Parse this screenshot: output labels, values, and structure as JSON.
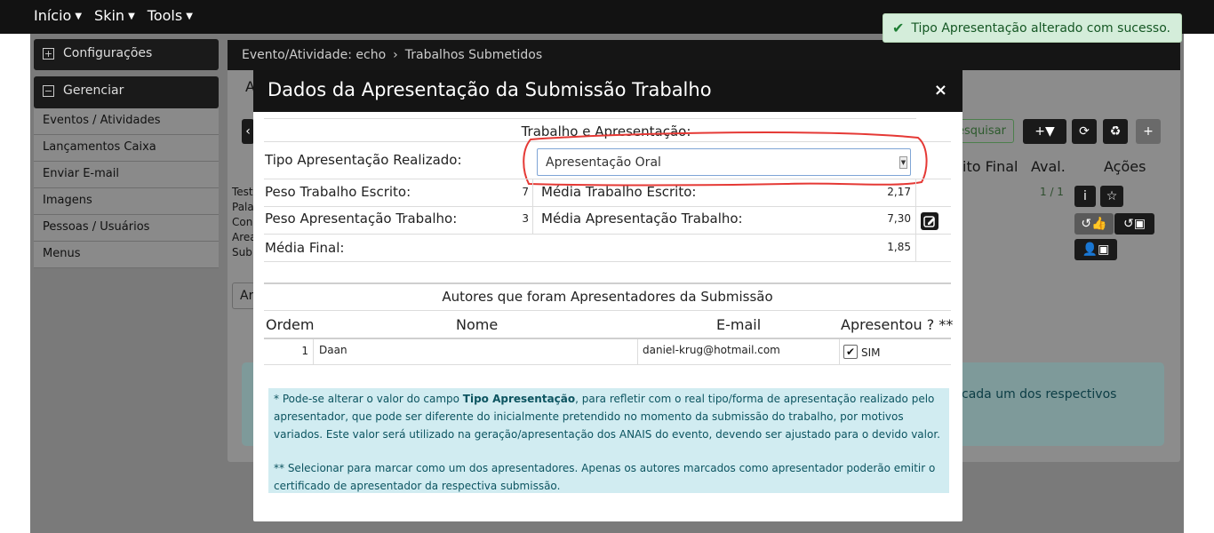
{
  "topnav": {
    "items": [
      "Início",
      "Skin",
      "Tools"
    ]
  },
  "sidebar": {
    "config_label": "Configurações",
    "manage_label": "Gerenciar",
    "items": [
      "Eventos / Atividades",
      "Lançamentos Caixa",
      "Enviar E-mail",
      "Imagens",
      "Pessoas / Usuários",
      "Menus"
    ]
  },
  "main": {
    "breadcrumb_event": "Evento/Atividade: echo",
    "breadcrumb_page": "Trabalhos Submetidos",
    "search_label": "esquisar",
    "col_final": "ito Final",
    "col_aval": "Aval.",
    "col_acoes": "Ações",
    "aval_value": "1 / 1",
    "info_fragment": "cada um dos respectivos",
    "left_fragments": [
      "Test",
      "Pala",
      "Con",
      "Area",
      "Sub"
    ],
    "tab_fragment": "Ar",
    "a_fragment": "A"
  },
  "toast": {
    "message": "Tipo Apresentação alterado com sucesso."
  },
  "modal": {
    "title": "Dados da Apresentação da Submissão Trabalho",
    "close": "×",
    "section1_title": "Trabalho e Apresentação:",
    "tipo_label": "Tipo Apresentação Realizado:",
    "tipo_value": "Apresentação Oral",
    "peso_escrito_label": "Peso Trabalho Escrito:",
    "peso_escrito_value": "7",
    "media_escrito_label": "Média Trabalho Escrito:",
    "media_escrito_value": "2,17",
    "peso_apres_label": "Peso Apresentação Trabalho:",
    "peso_apres_value": "3",
    "media_apres_label": "Média Apresentação Trabalho:",
    "media_apres_value": "7,30",
    "media_final_label": "Média Final:",
    "media_final_value": "1,85",
    "section2_title": "Autores que foram Apresentadores da Submissão",
    "table_headers": {
      "ordem": "Ordem",
      "nome": "Nome",
      "email": "E-mail",
      "apresentou": "Apresentou ? **"
    },
    "author": {
      "ordem": "1",
      "nome": "Daan",
      "email": "daniel-krug@hotmail.com",
      "apresentou": "SIM"
    },
    "note1_a": "* Pode-se alterar o valor do campo ",
    "note1_b": "Tipo Apresentação",
    "note1_c": ", para refletir com o real tipo/forma de apresentação realizado pelo apresentador, que pode ser diferente do inicialmente pretendido no momento da submissão do trabalho, por motivos variados. Este valor será utilizado na geração/apresentação dos ANAIS do evento, devendo ser ajustado para o devido valor.",
    "note2": "** Selecionar para marcar como um dos apresentadores. Apenas os autores marcados como apresentador poderão emitir o certificado de apresentador da respectiva submissão."
  },
  "colors": {
    "highlight": "#e53935",
    "toast_bg": "#d4edda",
    "note_bg": "#d1ecf1"
  }
}
